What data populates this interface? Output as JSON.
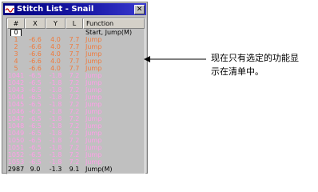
{
  "window": {
    "title": "Stitch List - Snail",
    "close_label": "✕"
  },
  "table": {
    "headers": [
      "#",
      "X",
      "Y",
      "L",
      "Function"
    ],
    "first_row": [
      "0",
      "",
      "",
      "",
      "Start, Jump(M)"
    ],
    "orange_rows": [
      [
        "1",
        "-6.6",
        "4.0",
        "7.7",
        "Jump"
      ],
      [
        "2",
        "-6.6",
        "4.0",
        "7.7",
        "Jump"
      ],
      [
        "3",
        "-6.6",
        "4.0",
        "7.7",
        "Jump"
      ],
      [
        "4",
        "-6.6",
        "4.0",
        "7.7",
        "Jump"
      ],
      [
        "5",
        "-6.6",
        "4.0",
        "7.7",
        "Jump"
      ]
    ],
    "pink_rows": [
      [
        "1041",
        "-6.5",
        "-1.8",
        "7.2",
        "Jump"
      ],
      [
        "1042",
        "-6.5",
        "-1.8",
        "7.2",
        "Jump"
      ],
      [
        "1043",
        "-6.5",
        "-1.8",
        "7.2",
        "Jump"
      ],
      [
        "1044",
        "-6.5",
        "-1.8",
        "7.2",
        "Jump"
      ],
      [
        "1045",
        "-6.5",
        "-1.8",
        "7.2",
        "Jump"
      ],
      [
        "1046",
        "-6.5",
        "-1.8",
        "7.2",
        "Jump"
      ],
      [
        "1047",
        "-6.5",
        "-1.8",
        "7.2",
        "Jump"
      ],
      [
        "1048",
        "-6.5",
        "-1.8",
        "7.2",
        "Jump"
      ],
      [
        "1049",
        "-6.5",
        "-1.8",
        "7.2",
        "Jump"
      ],
      [
        "1050",
        "-6.5",
        "-1.8",
        "7.2",
        "Jump"
      ],
      [
        "1051",
        "-6.5",
        "-1.8",
        "7.2",
        "Jump"
      ],
      [
        "1052",
        "-6.5",
        "-1.8",
        "7.2",
        "Jump"
      ],
      [
        "1053",
        "-6.5",
        "-1.8",
        "7.2",
        "Jump"
      ]
    ],
    "last_row": [
      "2987",
      "9.0",
      "-1.3",
      "9.1",
      "Jump(M)"
    ]
  },
  "annotation": {
    "line1": "现在只有选定的功能显",
    "line2": "示在清单中。"
  },
  "colors": {
    "orange_text": "#f07a3c",
    "pink_text": "#ff9ee8",
    "titlebar": "#000080"
  }
}
